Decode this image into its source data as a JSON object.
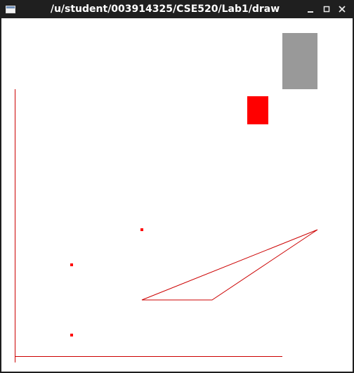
{
  "window": {
    "title": "/u/student/003914325/CSE520/Lab1/draw"
  },
  "titlebar_icons": {
    "app": "window-app-icon",
    "minimize": "minimize-icon",
    "maximize": "maximize-icon",
    "close": "close-icon"
  },
  "colors": {
    "titlebar_bg": "#1f1f1f",
    "title_text": "#ffffff",
    "canvas_bg": "#ffffff",
    "gray_rect": "#999999",
    "red": "#ff0000",
    "line_red": "#cc0000"
  }
}
